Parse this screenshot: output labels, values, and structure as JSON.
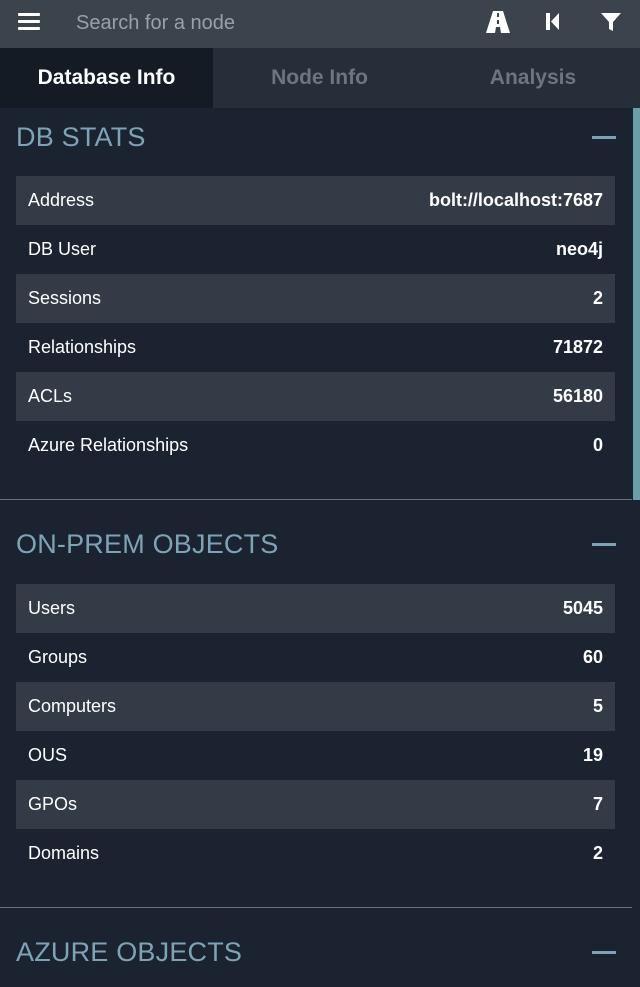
{
  "search": {
    "placeholder": "Search for a node"
  },
  "tabs": [
    {
      "label": "Database Info",
      "active": true
    },
    {
      "label": "Node Info",
      "active": false
    },
    {
      "label": "Analysis",
      "active": false
    }
  ],
  "sections": [
    {
      "title": "DB STATS",
      "rows": [
        {
          "label": "Address",
          "value": "bolt://localhost:7687"
        },
        {
          "label": "DB User",
          "value": "neo4j"
        },
        {
          "label": "Sessions",
          "value": "2"
        },
        {
          "label": "Relationships",
          "value": "71872"
        },
        {
          "label": "ACLs",
          "value": "56180"
        },
        {
          "label": "Azure Relationships",
          "value": "0"
        }
      ]
    },
    {
      "title": "ON-PREM OBJECTS",
      "rows": [
        {
          "label": "Users",
          "value": "5045"
        },
        {
          "label": "Groups",
          "value": "60"
        },
        {
          "label": "Computers",
          "value": "5"
        },
        {
          "label": "OUS",
          "value": "19"
        },
        {
          "label": "GPOs",
          "value": "7"
        },
        {
          "label": "Domains",
          "value": "2"
        }
      ]
    },
    {
      "title": "AZURE OBJECTS",
      "rows": []
    }
  ],
  "toolbar_icons": [
    "pathfinding-icon",
    "back-icon",
    "filter-icon"
  ],
  "colors": {
    "background": "#1b2330",
    "searchbar": "#3b434d",
    "row_alt": "#333b46",
    "section_title": "#7fa3b6",
    "active_tab": "#151b24"
  }
}
